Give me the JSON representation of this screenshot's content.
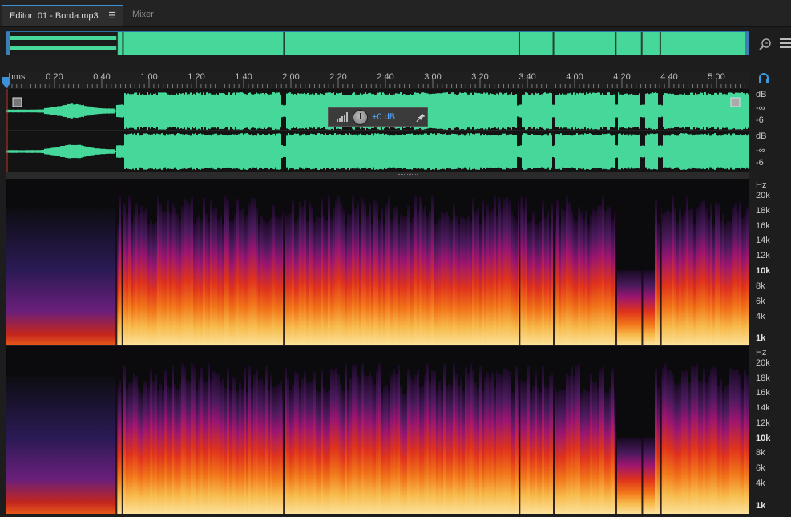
{
  "tabs": {
    "editor_label": "Editor: 01 - Borda.mp3",
    "editor_menu": "☰",
    "mixer_label": "Mixer"
  },
  "ruler": {
    "ticks": [
      "hms",
      "0:20",
      "0:40",
      "1:00",
      "1:20",
      "1:40",
      "2:00",
      "2:20",
      "2:40",
      "3:00",
      "3:20",
      "3:40",
      "4:00",
      "4:20",
      "4:40",
      "5:00"
    ]
  },
  "waveform": {
    "channels": [
      {
        "db_labels": [
          "dB",
          "-∞",
          "-6"
        ]
      },
      {
        "db_labels": [
          "dB",
          "-∞",
          "-6"
        ]
      }
    ],
    "color": "#46d79a"
  },
  "hud": {
    "volume_value": "+0 dB"
  },
  "spectrogram": {
    "channels": [
      {
        "hz_labels": [
          "Hz",
          "20k",
          "18k",
          "16k",
          "14k",
          "12k",
          "10k",
          "8k",
          "6k",
          "4k",
          "1k"
        ]
      },
      {
        "hz_labels": [
          "Hz",
          "20k",
          "18k",
          "16k",
          "14k",
          "12k",
          "10k",
          "8k",
          "6k",
          "4k",
          "1k"
        ]
      }
    ],
    "bold_labels": [
      "10k",
      "1k"
    ]
  },
  "icons": {
    "zoom": "zoom-icon",
    "list": "list-icon",
    "headphone": "headphone-icon",
    "volume": "volume-icon",
    "pin": "pin-icon"
  },
  "colors": {
    "accent": "#3d8fd6",
    "wave": "#46d79a",
    "hud_value": "#53a8ff"
  }
}
